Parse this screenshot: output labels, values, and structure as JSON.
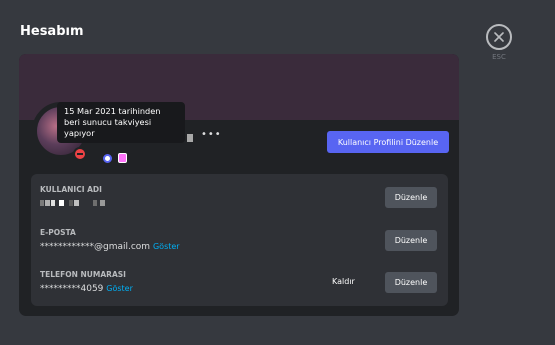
{
  "page": {
    "title": "Hesabım"
  },
  "close": {
    "label": "ESC",
    "icon": "close-icon"
  },
  "profile": {
    "tooltip": "15 Mar 2021 tarihinden beri sunucu takviyesi yapıyor",
    "status": "do-not-disturb",
    "status_color": "#ed4245",
    "edit_profile_label": "Kullanıcı Profilini Düzenle",
    "accent_color": "#5865f2",
    "badges": [
      "nitro-badge",
      "server-boost-badge"
    ]
  },
  "fields": {
    "username": {
      "label": "KULLANICI ADI",
      "edit_label": "Düzenle"
    },
    "email": {
      "label": "E-POSTA",
      "value": "************@gmail.com",
      "reveal_label": "Göster",
      "edit_label": "Düzenle"
    },
    "phone": {
      "label": "TELEFON NUMARASI",
      "value": "*********4059",
      "reveal_label": "Göster",
      "remove_label": "Kaldır",
      "edit_label": "Düzenle"
    }
  }
}
